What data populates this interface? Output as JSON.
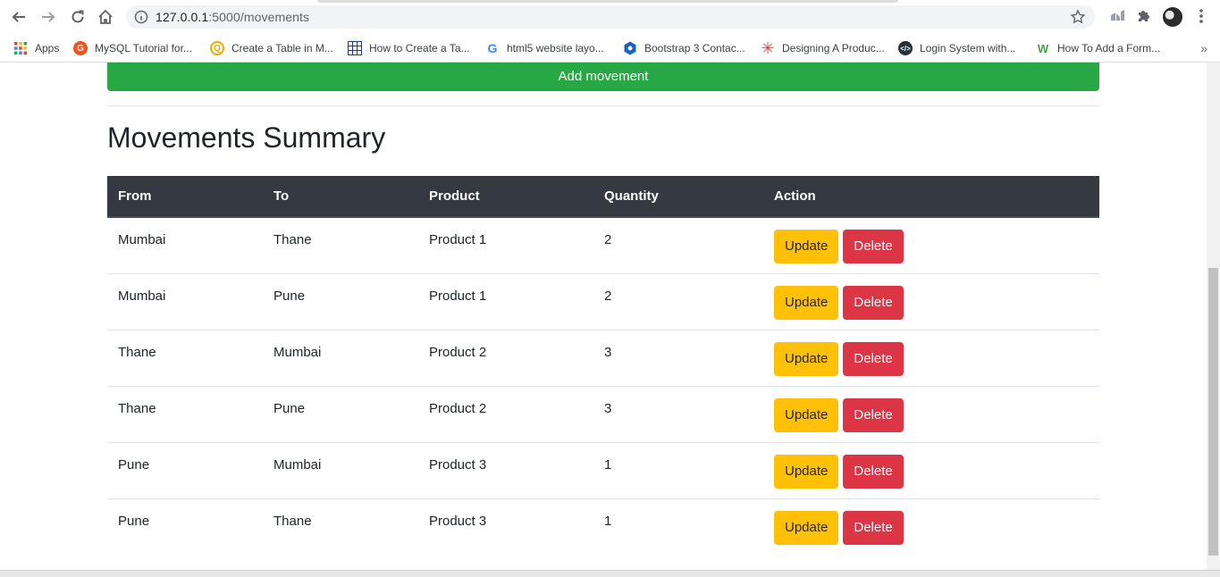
{
  "browser": {
    "url_host": "127.0.0.1",
    "url_path": ":5000/movements",
    "bookmarks": [
      {
        "label": "Apps",
        "icon": "apps-grid-icon",
        "color": "#ea4335"
      },
      {
        "label": "MySQL Tutorial for...",
        "icon": "mysql-tutorial-icon",
        "color": "#f4511e"
      },
      {
        "label": "Create a Table in M...",
        "icon": "quip-icon",
        "color": "#f6a700"
      },
      {
        "label": "How to Create a Ta...",
        "icon": "table-grid-icon",
        "color": "#1a3a8a"
      },
      {
        "label": "html5 website layo...",
        "icon": "google-icon",
        "color": "#4285f4"
      },
      {
        "label": "Bootstrap 3 Contac...",
        "icon": "bootstrap-hex-icon",
        "color": "#1e88e5"
      },
      {
        "label": "Designing A Produc...",
        "icon": "asterisk-icon",
        "color": "#e53935"
      },
      {
        "label": "Login System with...",
        "icon": "code-icon",
        "color": "#263238"
      },
      {
        "label": "How To Add a Form...",
        "icon": "w-logo-icon",
        "color": "#43a047"
      }
    ]
  },
  "page": {
    "add_button_label": "Add movement",
    "title": "Movements Summary",
    "accent_colors": {
      "add": "#28a745",
      "update": "#ffc107",
      "delete": "#dc3545",
      "header_bg": "#343a40"
    }
  },
  "table": {
    "headers": [
      "From",
      "To",
      "Product",
      "Quantity",
      "Action"
    ],
    "rows": [
      {
        "from": "Mumbai",
        "to": "Thane",
        "product": "Product 1",
        "quantity": "2",
        "update": "Update",
        "delete": "Delete"
      },
      {
        "from": "Mumbai",
        "to": "Pune",
        "product": "Product 1",
        "quantity": "2",
        "update": "Update",
        "delete": "Delete"
      },
      {
        "from": "Thane",
        "to": "Mumbai",
        "product": "Product 2",
        "quantity": "3",
        "update": "Update",
        "delete": "Delete"
      },
      {
        "from": "Thane",
        "to": "Pune",
        "product": "Product 2",
        "quantity": "3",
        "update": "Update",
        "delete": "Delete"
      },
      {
        "from": "Pune",
        "to": "Mumbai",
        "product": "Product 3",
        "quantity": "1",
        "update": "Update",
        "delete": "Delete"
      },
      {
        "from": "Pune",
        "to": "Thane",
        "product": "Product 3",
        "quantity": "1",
        "update": "Update",
        "delete": "Delete"
      }
    ]
  }
}
